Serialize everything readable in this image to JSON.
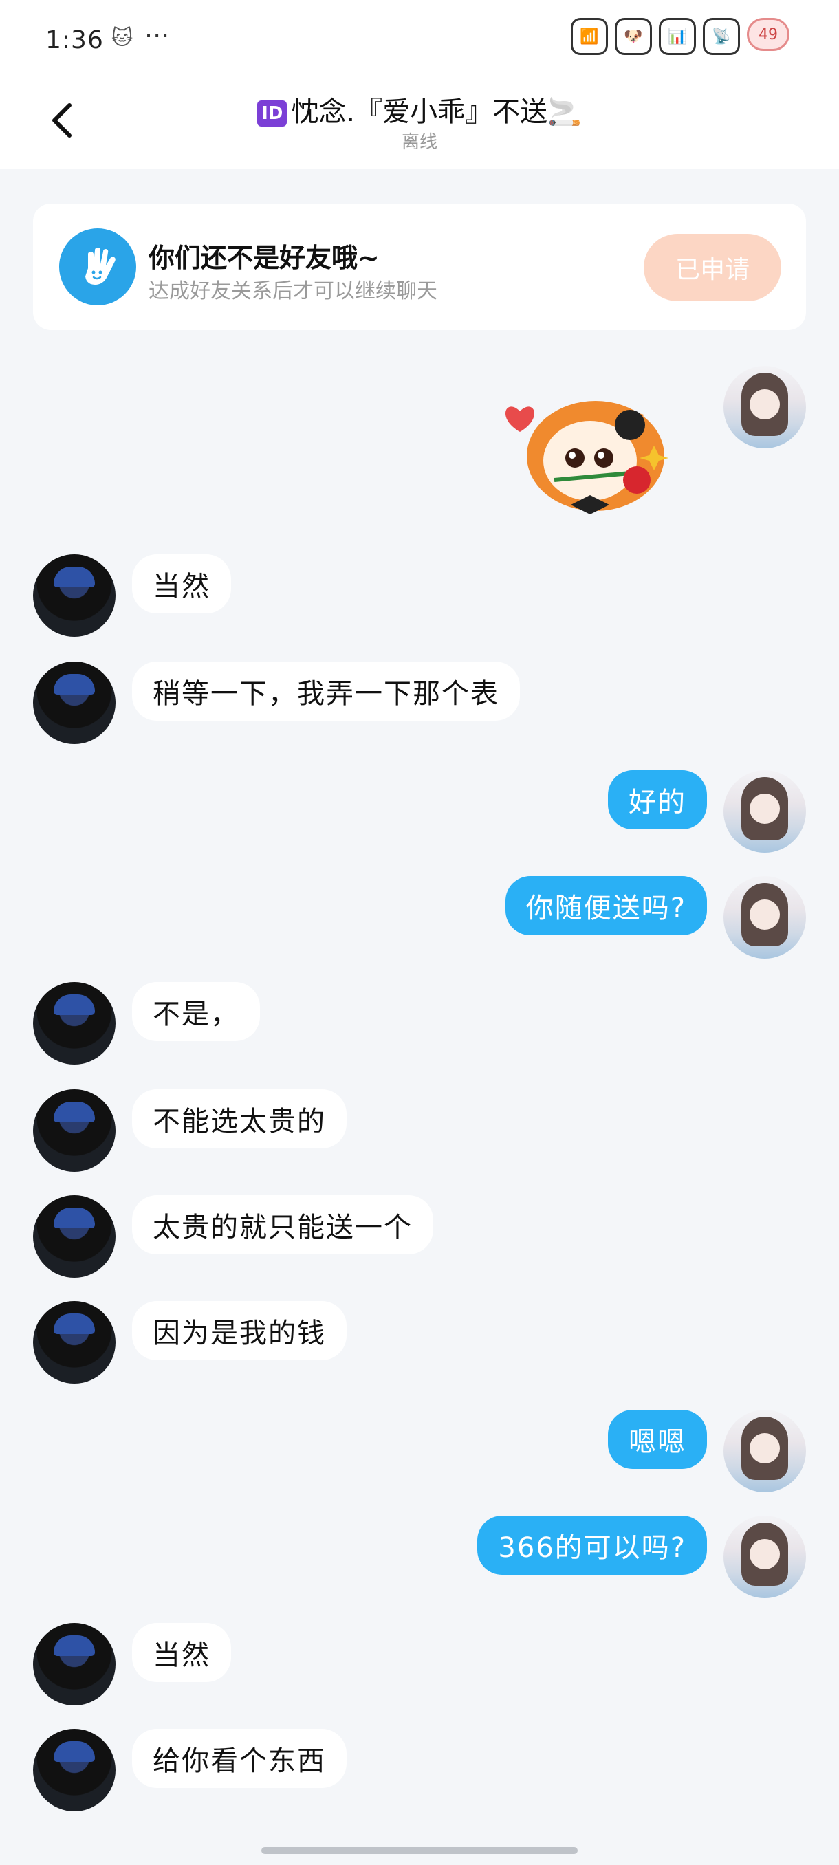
{
  "status_bar": {
    "time": "1:36",
    "extra": "🐱",
    "dots": "···",
    "battery": "49"
  },
  "header": {
    "id_badge": "ID",
    "title": "忱念.『爱小乖』不送🚬",
    "status": "离线"
  },
  "banner": {
    "title": "你们还不是好友哦~",
    "subtitle": "达成好友关系后才可以继续聊天",
    "button": "已申请"
  },
  "messages": [
    {
      "side": "right",
      "type": "sticker"
    },
    {
      "side": "left",
      "text": "当然"
    },
    {
      "side": "left",
      "text": "稍等一下，我弄一下那个表"
    },
    {
      "side": "right",
      "text": "好的"
    },
    {
      "side": "right",
      "text": "你随便送吗?"
    },
    {
      "side": "left",
      "text": "不是，"
    },
    {
      "side": "left",
      "text": "不能选太贵的"
    },
    {
      "side": "left",
      "text": "太贵的就只能送一个"
    },
    {
      "side": "left",
      "text": "因为是我的钱"
    },
    {
      "side": "right",
      "text": "嗯嗯"
    },
    {
      "side": "right",
      "text": "366的可以吗?"
    },
    {
      "side": "left",
      "text": "当然"
    },
    {
      "side": "left",
      "text": "给你看个东西"
    }
  ],
  "colors": {
    "bubble_self": "#2ab0f5",
    "banner_button": "#fcd6c4",
    "banner_icon": "#2aa4e8"
  }
}
